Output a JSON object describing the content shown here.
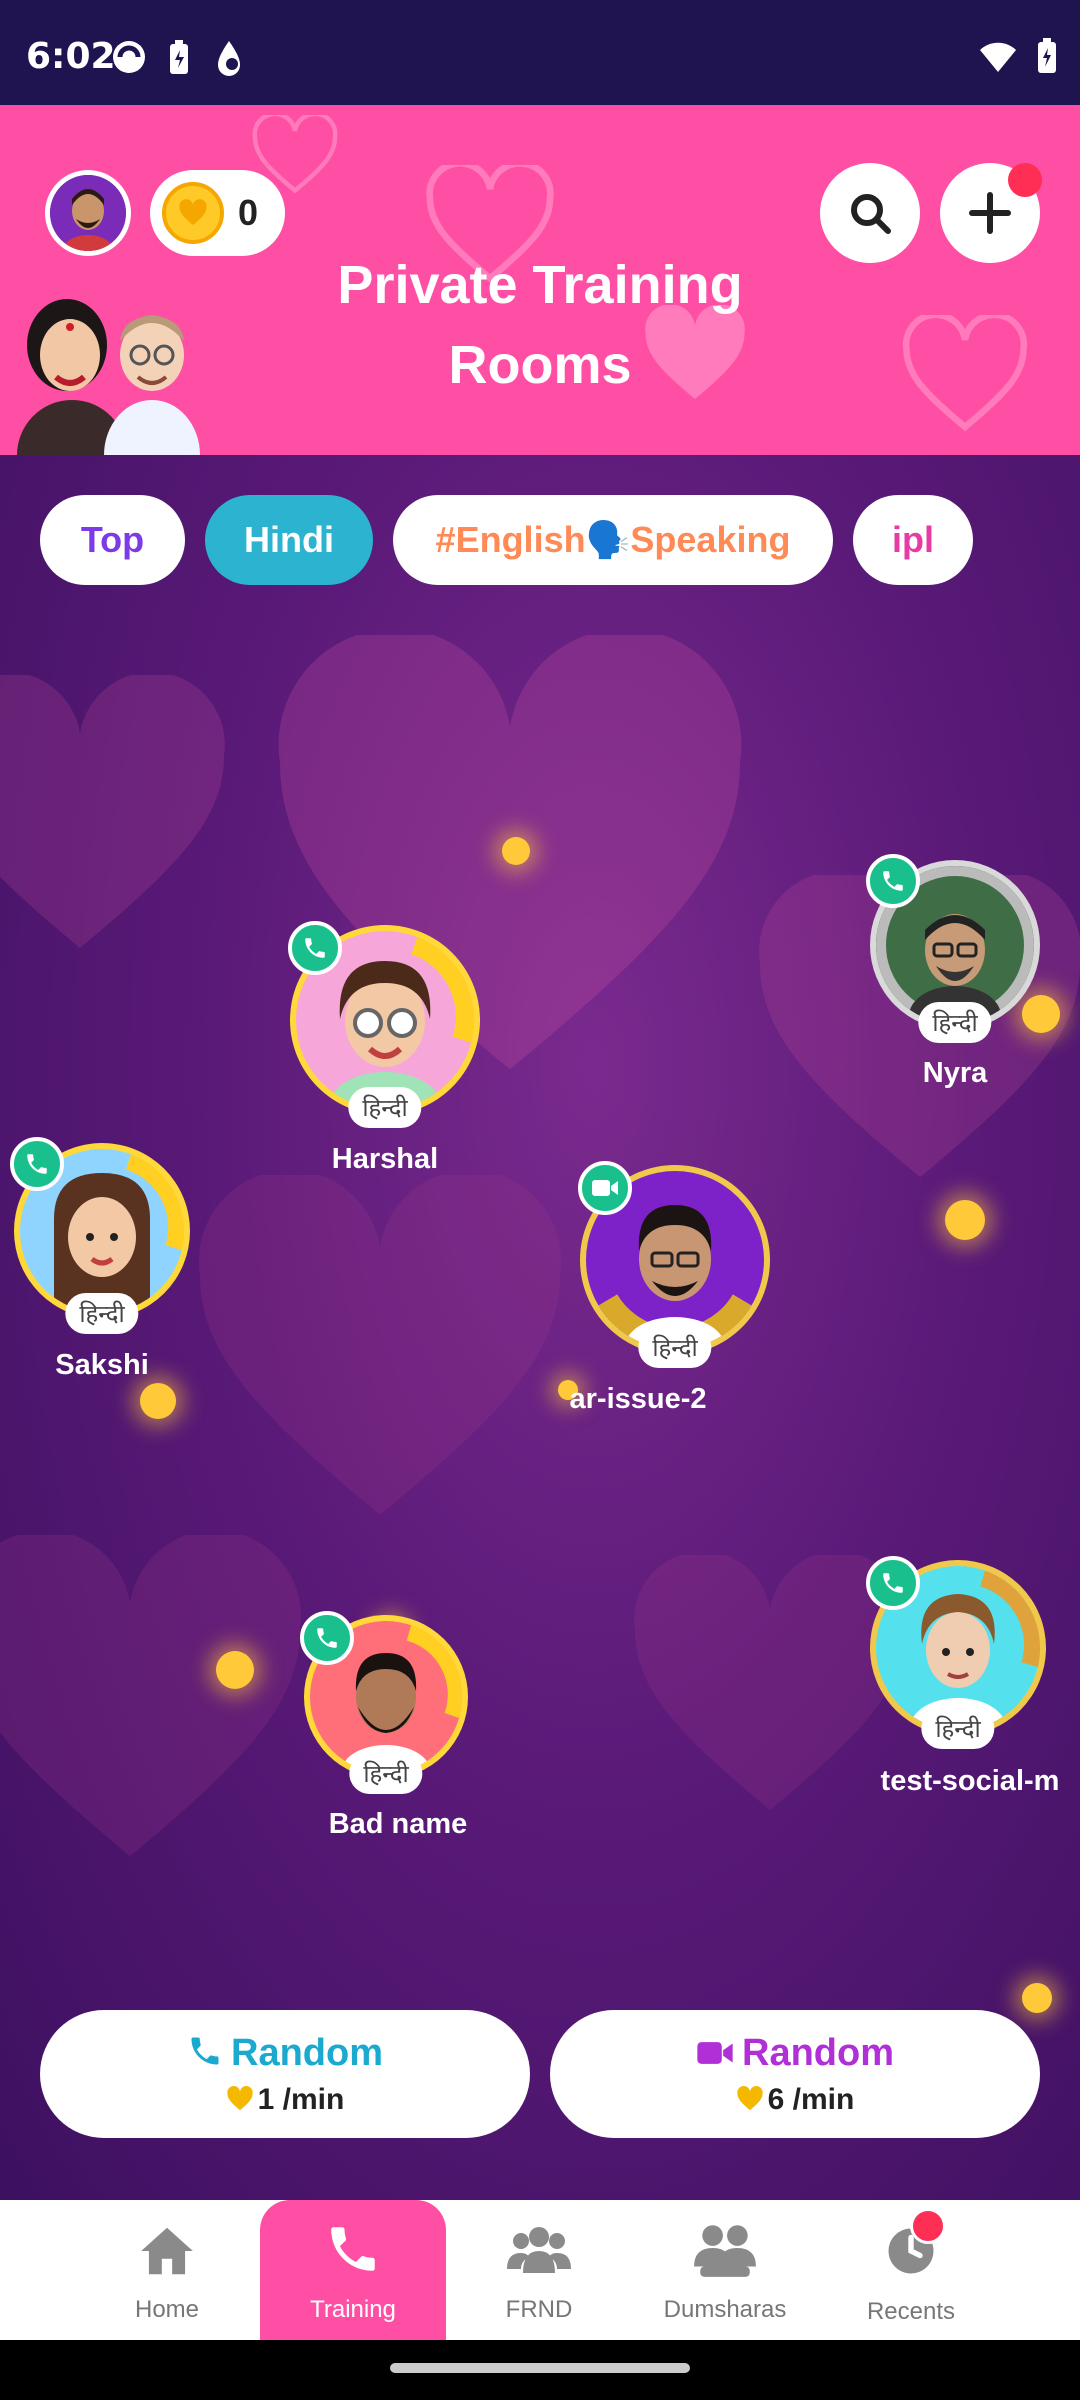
{
  "status_bar": {
    "time": "6:02"
  },
  "header": {
    "title_line1": "Private Training",
    "title_line2": "Rooms",
    "coin_count": "0",
    "accent_color": "#ff4fa5"
  },
  "chips": [
    {
      "label": "Top"
    },
    {
      "label": "Hindi"
    },
    {
      "label": "#English🗣️Speaking"
    },
    {
      "label": "ipl"
    }
  ],
  "users": [
    {
      "name": "Nyra",
      "language": "हिन्दी",
      "call_type": "audio"
    },
    {
      "name": "Harshal",
      "language": "हिन्दी",
      "call_type": "audio"
    },
    {
      "name": "Sakshi",
      "language": "हिन्दी",
      "call_type": "audio"
    },
    {
      "name": "ar-issue-2",
      "language": "हिन्दी",
      "call_type": "video"
    },
    {
      "name": "Bad name",
      "language": "हिन्दी",
      "call_type": "audio"
    },
    {
      "name": "test-social-m",
      "language": "हिन्दी",
      "call_type": "audio"
    }
  ],
  "random_buttons": [
    {
      "label": "Random",
      "price": "1 /min",
      "color": "#1aa9cf",
      "type": "audio"
    },
    {
      "label": "Random",
      "price": "6 /min",
      "color": "#b02fd6",
      "type": "video"
    }
  ],
  "bottom_nav": [
    {
      "label": "Home",
      "icon": "home-icon"
    },
    {
      "label": "Training",
      "icon": "phone-icon",
      "active": true
    },
    {
      "label": "FRND",
      "icon": "people-icon"
    },
    {
      "label": "Dumsharas",
      "icon": "group-icon"
    },
    {
      "label": "Recents",
      "icon": "clock-icon"
    }
  ]
}
